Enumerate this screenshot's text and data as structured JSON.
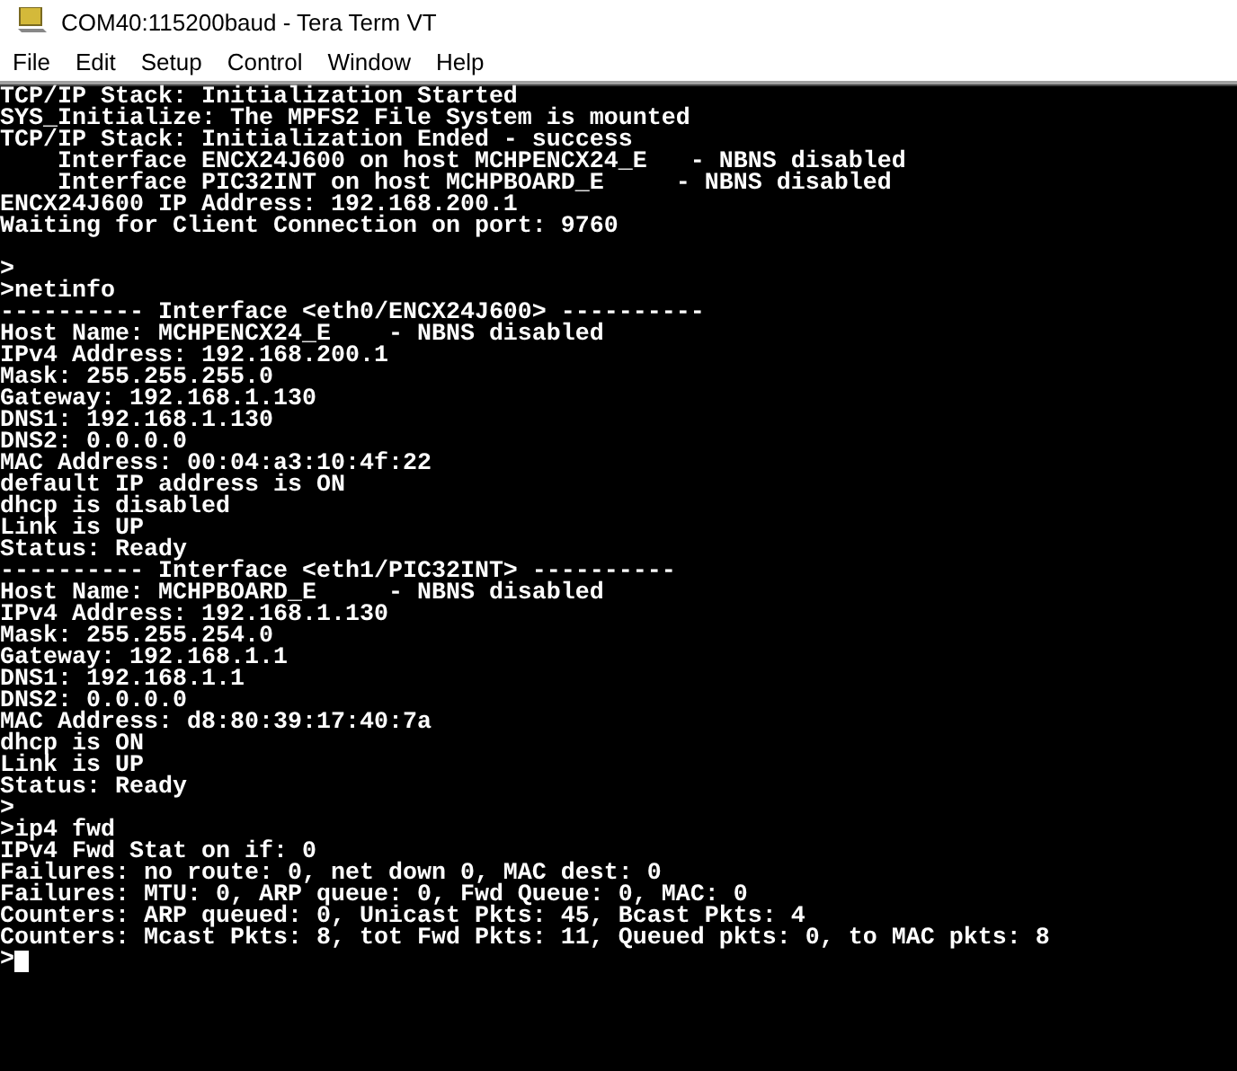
{
  "window": {
    "title": "COM40:115200baud - Tera Term VT"
  },
  "menu": [
    {
      "label": "File"
    },
    {
      "label": "Edit"
    },
    {
      "label": "Setup"
    },
    {
      "label": "Control"
    },
    {
      "label": "Window"
    },
    {
      "label": "Help"
    }
  ],
  "terminal": {
    "blocks": [
      [
        "TCP/IP Stack: Initialization Started",
        "SYS_Initialize: The MPFS2 File System is mounted",
        "TCP/IP Stack: Initialization Ended - success",
        "    Interface ENCX24J600 on host MCHPENCX24_E   - NBNS disabled",
        "    Interface PIC32INT on host MCHPBOARD_E     - NBNS disabled",
        "ENCX24J600 IP Address: 192.168.200.1",
        "Waiting for Client Connection on port: 9760"
      ],
      [
        ">",
        ">netinfo",
        "---------- Interface <eth0/ENCX24J600> ----------",
        "Host Name: MCHPENCX24_E    - NBNS disabled",
        "IPv4 Address: 192.168.200.1",
        "Mask: 255.255.255.0",
        "Gateway: 192.168.1.130",
        "DNS1: 192.168.1.130",
        "DNS2: 0.0.0.0",
        "MAC Address: 00:04:a3:10:4f:22",
        "default IP address is ON",
        "dhcp is disabled",
        "Link is UP",
        "Status: Ready",
        "---------- Interface <eth1/PIC32INT> ----------",
        "Host Name: MCHPBOARD_E     - NBNS disabled",
        "IPv4 Address: 192.168.1.130",
        "Mask: 255.255.254.0",
        "Gateway: 192.168.1.1",
        "DNS1: 192.168.1.1",
        "DNS2: 0.0.0.0",
        "MAC Address: d8:80:39:17:40:7a",
        "dhcp is ON",
        "Link is UP",
        "Status: Ready",
        ">",
        ">ip4 fwd",
        "IPv4 Fwd Stat on if: 0",
        "Failures: no route: 0, net down 0, MAC dest: 0",
        "Failures: MTU: 0, ARP queue: 0, Fwd Queue: 0, MAC: 0",
        "Counters: ARP queued: 0, Unicast Pkts: 45, Bcast Pkts: 4",
        "Counters: Mcast Pkts: 8, tot Fwd Pkts: 11, Queued pkts: 0, to MAC pkts: 8"
      ]
    ],
    "prompt": ">"
  }
}
